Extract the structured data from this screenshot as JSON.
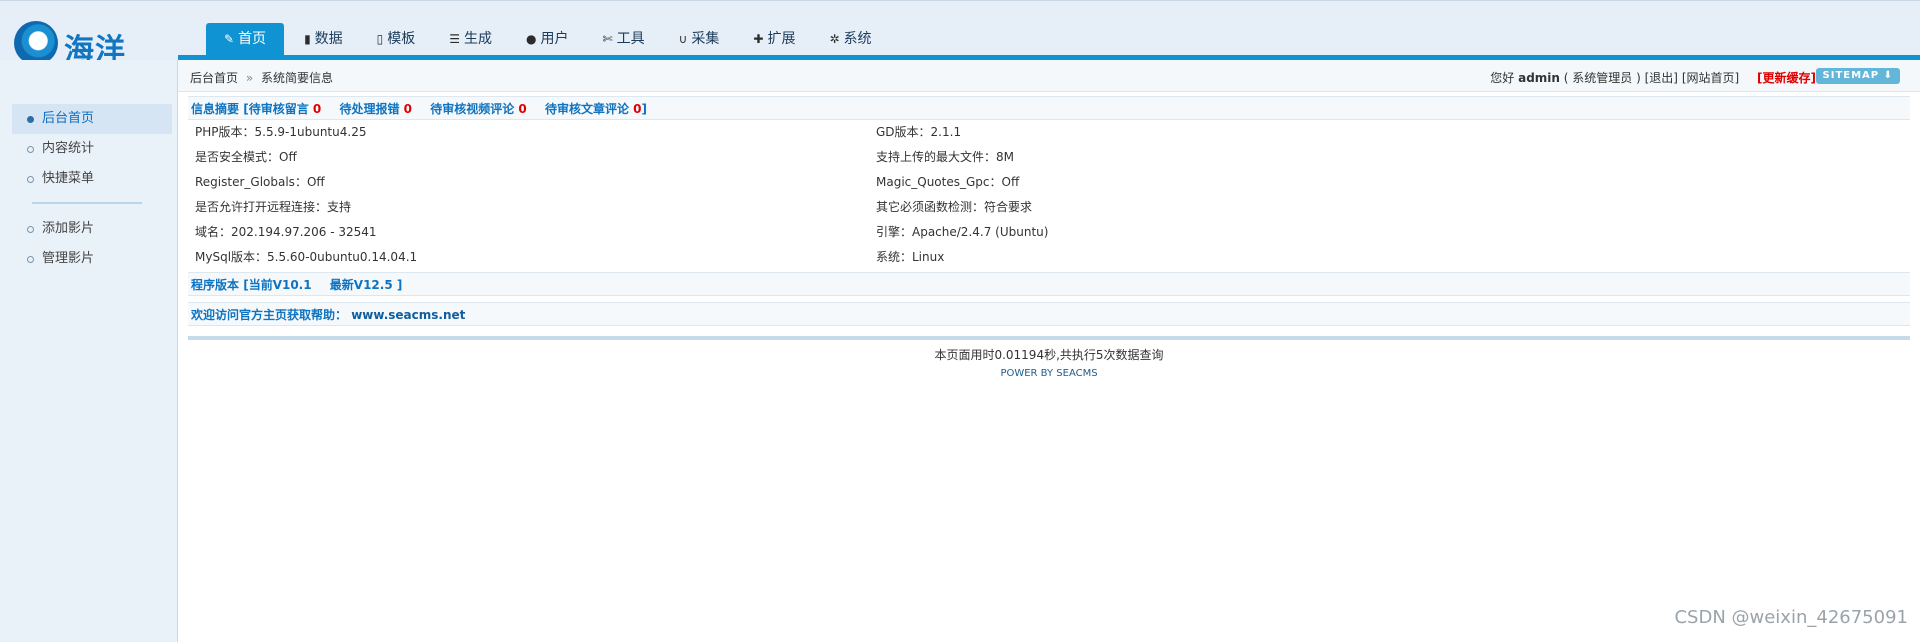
{
  "logo": {
    "text": "海洋"
  },
  "nav": [
    {
      "label": "首页",
      "icon": "edit-icon",
      "glyph": "✎",
      "active": true
    },
    {
      "label": "数据",
      "icon": "book-icon",
      "glyph": "▮"
    },
    {
      "label": "模板",
      "icon": "file-icon",
      "glyph": "▯"
    },
    {
      "label": "生成",
      "icon": "server-icon",
      "glyph": "☰"
    },
    {
      "label": "用户",
      "icon": "user-icon",
      "glyph": "●"
    },
    {
      "label": "工具",
      "icon": "wrench-icon",
      "glyph": "✄"
    },
    {
      "label": "采集",
      "icon": "magnet-icon",
      "glyph": "∪"
    },
    {
      "label": "扩展",
      "icon": "puzzle-icon",
      "glyph": "✚"
    },
    {
      "label": "系统",
      "icon": "gear-icon",
      "glyph": "✲"
    }
  ],
  "breadcrumb": {
    "home": "后台首页",
    "separator": "»",
    "current": "系统简要信息"
  },
  "user": {
    "greeting": "您好",
    "name": "admin",
    "role": "( 系统管理员 )",
    "logout": "[退出]",
    "site_home": "[网站首页]",
    "update_cache": "[更新缓存]",
    "sitemap": "SITEMAP ⬇"
  },
  "sidebar": {
    "group1": [
      {
        "label": "后台首页",
        "active": true
      },
      {
        "label": "内容统计"
      },
      {
        "label": "快捷菜单"
      }
    ],
    "group2": [
      {
        "label": "添加影片"
      },
      {
        "label": "管理影片"
      }
    ]
  },
  "summary": {
    "title": "信息摘要",
    "pending_message": "[待审核留言",
    "pending_message_count": "0",
    "pending_error": "待处理报错",
    "pending_error_count": "0",
    "pending_video_comment": "待审核视频评论",
    "pending_video_comment_count": "0",
    "pending_article_comment": "待审核文章评论",
    "pending_article_comment_count": "0",
    "close": "]"
  },
  "info": [
    [
      "PHP版本：5.5.9-1ubuntu4.25",
      "GD版本：2.1.1"
    ],
    [
      "是否安全模式：Off",
      "支持上传的最大文件：8M"
    ],
    [
      "Register_Globals：Off",
      "Magic_Quotes_Gpc：Off"
    ],
    [
      "是否允许打开远程连接：支持",
      "其它必须函数检测：符合要求"
    ],
    [
      "域名：202.194.97.206 - 32541",
      "引擎：Apache/2.4.7 (Ubuntu)"
    ],
    [
      "MySql版本：5.5.60-0ubuntu0.14.04.1",
      "系统：Linux"
    ]
  ],
  "version": {
    "title": "程序版本",
    "current": "[当前V10.1",
    "latest": "最新V12.5 ]"
  },
  "welcome": {
    "text": "欢迎访问官方主页获取帮助：",
    "url": "www.seacms.net"
  },
  "footer": {
    "stats": "本页面用时0.01194秒,共执行5次数据查询",
    "power": "POWER BY SEACMS"
  },
  "watermark": "CSDN @weixin_42675091"
}
